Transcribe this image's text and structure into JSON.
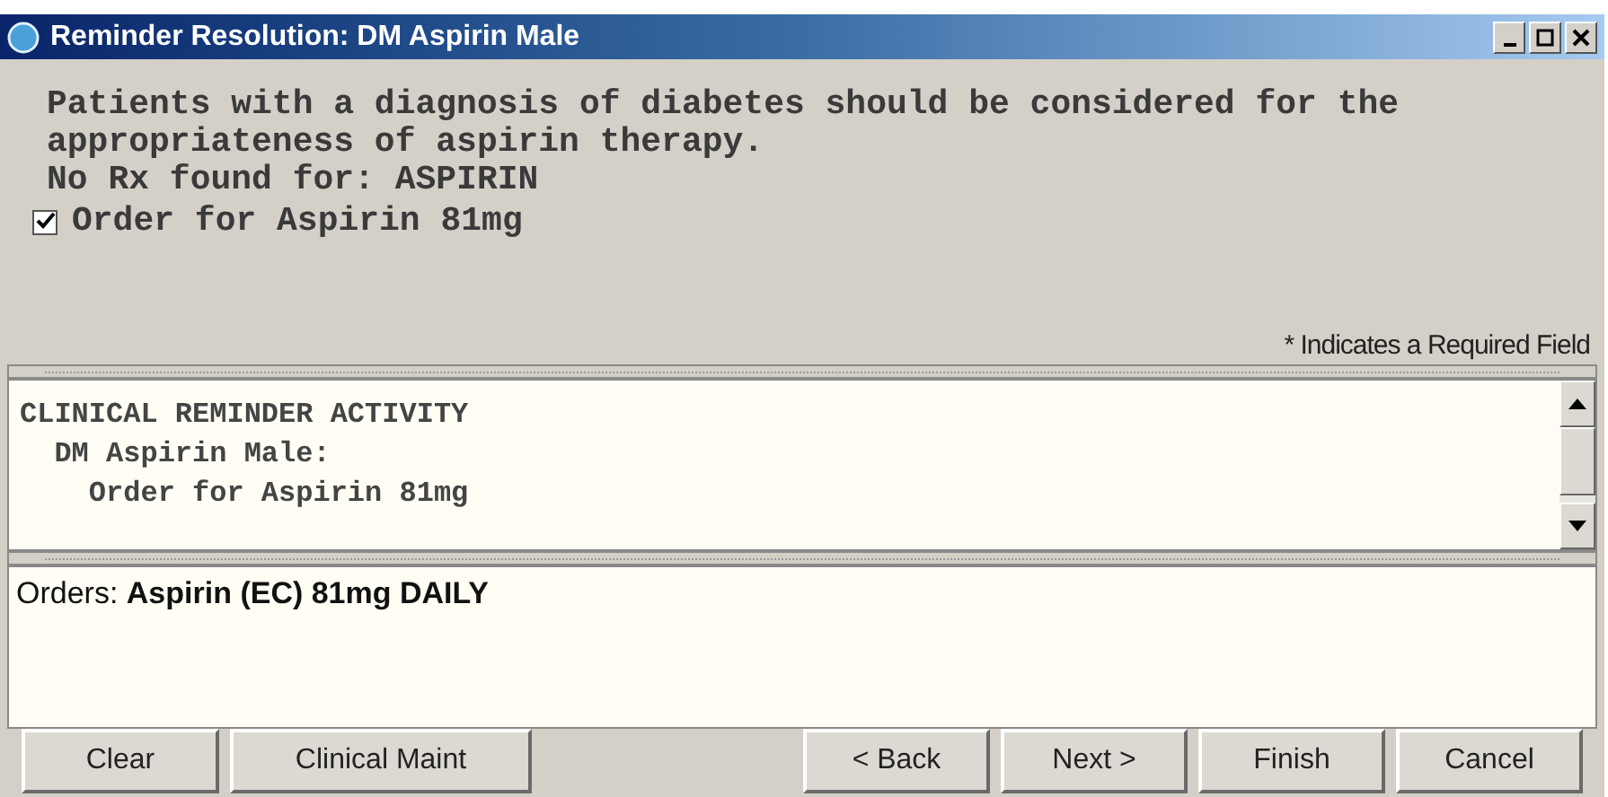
{
  "window": {
    "title": "Reminder Resolution: DM Aspirin Male"
  },
  "message_lines": [
    "Patients with a diagnosis of diabetes should be considered for the",
    "appropriateness of aspirin therapy.",
    "No Rx found for: ASPIRIN"
  ],
  "order_checkbox": {
    "label": "Order for Aspirin 81mg",
    "checked": true
  },
  "required_note": "* Indicates a Required Field",
  "activity_lines": [
    "CLINICAL REMINDER ACTIVITY",
    "  DM Aspirin Male:",
    "    Order for Aspirin 81mg"
  ],
  "orders_text": "Orders: **Aspirin (EC) 81mg DAILY**",
  "buttons_left": [
    "Clear",
    "Clinical Maint"
  ],
  "buttons_right": [
    "< Back",
    "Next >",
    "Finish",
    "Cancel"
  ]
}
